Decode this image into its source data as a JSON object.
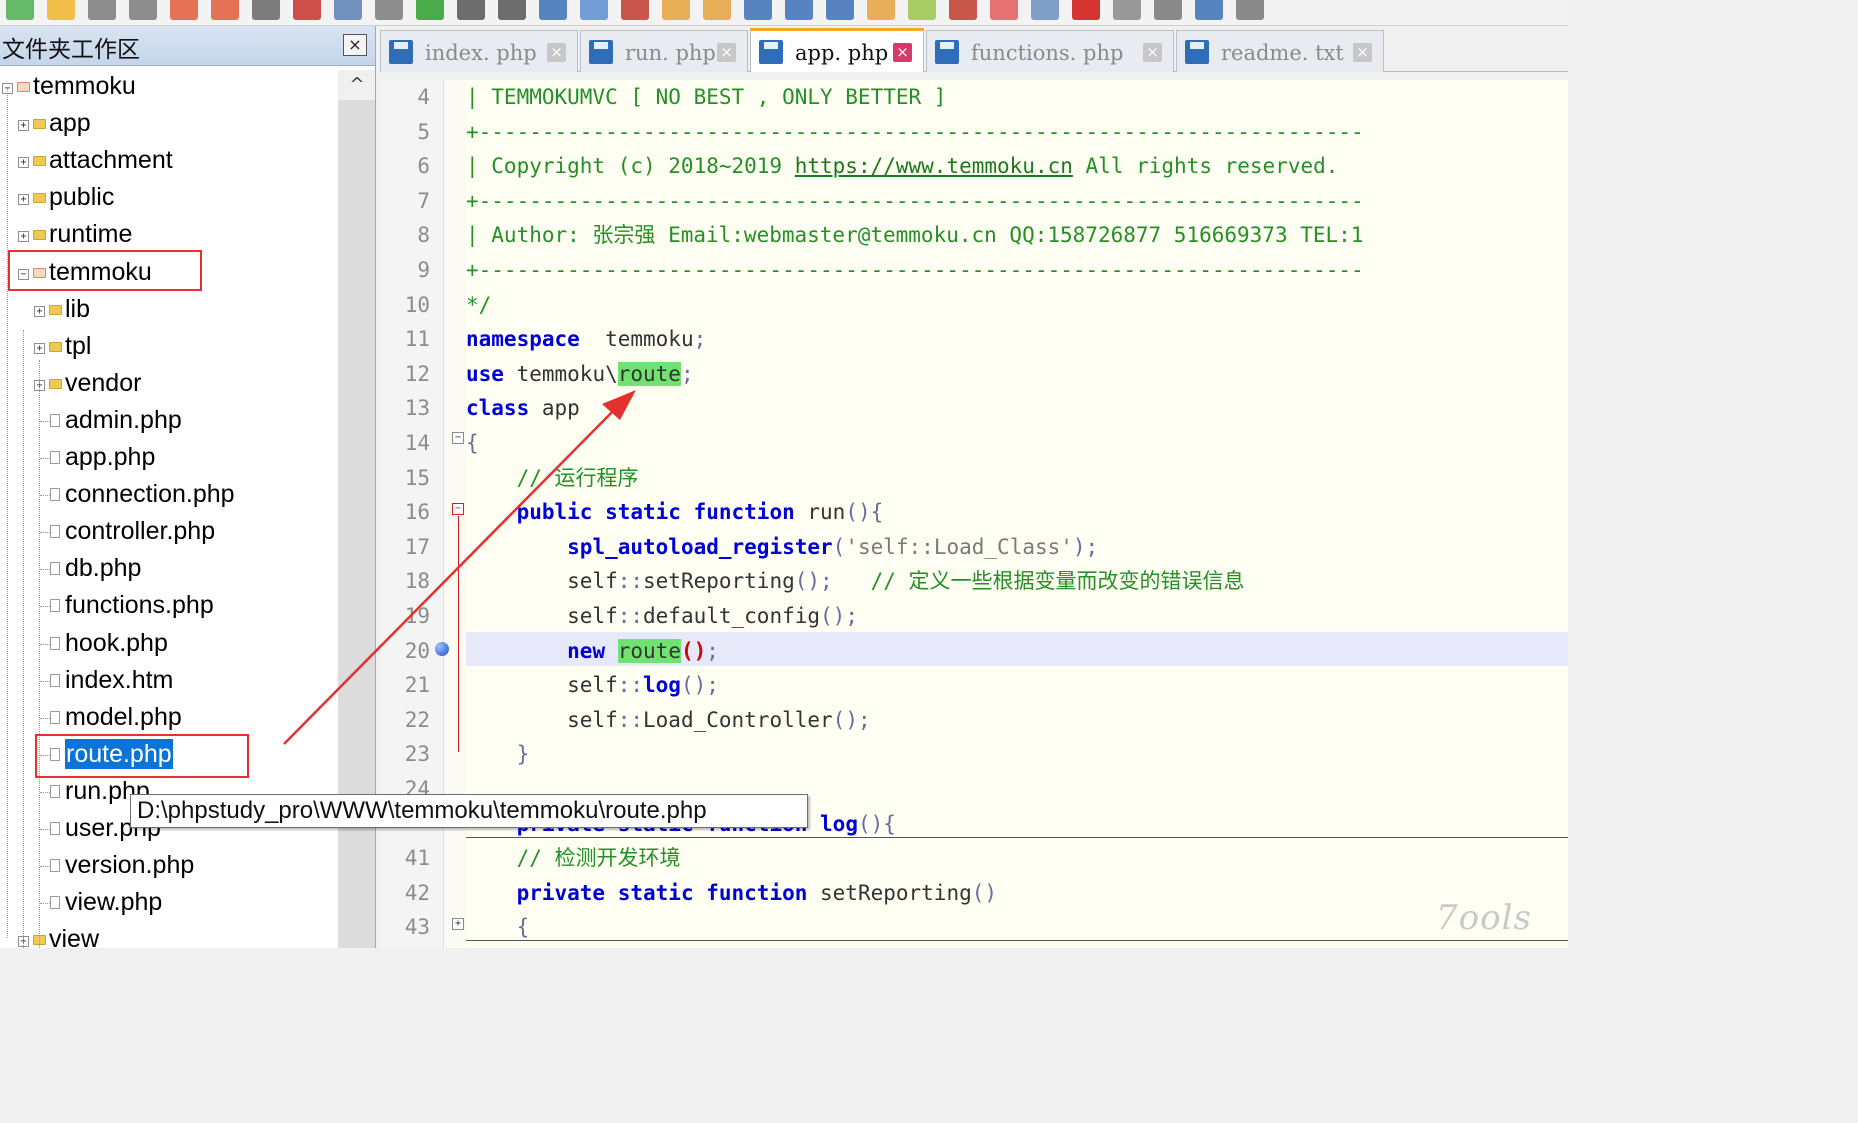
{
  "toolbar": {
    "icons": [
      "new-file-icon",
      "open-folder-icon",
      "save-icon",
      "save-all-icon",
      "close-file-icon",
      "close-all-icon",
      "print-icon",
      "cut-icon",
      "copy-icon",
      "paste-icon",
      "undo-icon",
      "redo-icon",
      "find-icon",
      "replace-icon",
      "zoom-in-icon",
      "zoom-out-icon",
      "lock-icon",
      "unlock-icon",
      "wrap-icon",
      "indent-icon",
      "format-icon",
      "bookmark-icon",
      "color-icon",
      "edit-icon",
      "window-icon",
      "view-icon",
      "record-icon",
      "stop-icon",
      "play-icon",
      "playback-icon",
      "save-macro-icon"
    ]
  },
  "left_panel": {
    "title": "文件夹工作区",
    "close_label": "×",
    "scroll_up_label": "^",
    "tree": [
      {
        "label": "temmoku",
        "level": 0,
        "type": "folder",
        "expanded": true
      },
      {
        "label": "app",
        "level": 1,
        "type": "folder",
        "expanded": false
      },
      {
        "label": "attachment",
        "level": 1,
        "type": "folder",
        "expanded": false
      },
      {
        "label": "public",
        "level": 1,
        "type": "folder",
        "expanded": false
      },
      {
        "label": "runtime",
        "level": 1,
        "type": "folder",
        "expanded": false
      },
      {
        "label": "temmoku",
        "level": 1,
        "type": "folder",
        "expanded": true
      },
      {
        "label": "lib",
        "level": 2,
        "type": "folder",
        "expanded": false
      },
      {
        "label": "tpl",
        "level": 2,
        "type": "folder",
        "expanded": false
      },
      {
        "label": "vendor",
        "level": 2,
        "type": "folder",
        "expanded": false
      },
      {
        "label": "admin.php",
        "level": 2,
        "type": "file"
      },
      {
        "label": "app.php",
        "level": 2,
        "type": "file"
      },
      {
        "label": "connection.php",
        "level": 2,
        "type": "file"
      },
      {
        "label": "controller.php",
        "level": 2,
        "type": "file"
      },
      {
        "label": "db.php",
        "level": 2,
        "type": "file"
      },
      {
        "label": "functions.php",
        "level": 2,
        "type": "file"
      },
      {
        "label": "hook.php",
        "level": 2,
        "type": "file"
      },
      {
        "label": "index.htm",
        "level": 2,
        "type": "file"
      },
      {
        "label": "model.php",
        "level": 2,
        "type": "file"
      },
      {
        "label": "route.php",
        "level": 2,
        "type": "file",
        "selected": true
      },
      {
        "label": "run.php",
        "level": 2,
        "type": "file"
      },
      {
        "label": "user.php",
        "level": 2,
        "type": "file"
      },
      {
        "label": "version.php",
        "level": 2,
        "type": "file"
      },
      {
        "label": "view.php",
        "level": 2,
        "type": "file"
      },
      {
        "label": "view",
        "level": 1,
        "type": "folder",
        "expanded": false
      }
    ]
  },
  "tabs": [
    {
      "label": "index. php",
      "active": false
    },
    {
      "label": "run. php",
      "active": false
    },
    {
      "label": "app. php",
      "active": true
    },
    {
      "label": "functions. php",
      "active": false
    },
    {
      "label": "readme. txt",
      "active": false
    }
  ],
  "tab_close_label": "×",
  "editor": {
    "lines": [
      {
        "n": "4",
        "parts": [
          [
            "cm",
            "| TEMMOKUMVC [ NO BEST , ONLY BETTER ]"
          ]
        ]
      },
      {
        "n": "5",
        "parts": [
          [
            "cm",
            "+----------------------------------------------------------------------"
          ]
        ]
      },
      {
        "n": "6",
        "parts": [
          [
            "cm",
            "| Copyright (c) 2018~2019 "
          ],
          [
            "url",
            "https://www.temmoku.cn"
          ],
          [
            "cm",
            " All rights reserved."
          ]
        ]
      },
      {
        "n": "7",
        "parts": [
          [
            "cm",
            "+----------------------------------------------------------------------"
          ]
        ]
      },
      {
        "n": "8",
        "parts": [
          [
            "cm",
            "| Author: 张宗强 Email:webmaster@temmoku.cn QQ:158726877 516669373 TEL:1"
          ]
        ]
      },
      {
        "n": "9",
        "parts": [
          [
            "cm",
            "+----------------------------------------------------------------------"
          ]
        ]
      },
      {
        "n": "10",
        "parts": [
          [
            "cm",
            "*/"
          ]
        ]
      },
      {
        "n": "11",
        "parts": [
          [
            "kw",
            "namespace"
          ],
          [
            "",
            "  temmoku"
          ],
          [
            "op",
            ";"
          ]
        ]
      },
      {
        "n": "12",
        "parts": [
          [
            "kw",
            "use"
          ],
          [
            "",
            " temmoku\\"
          ],
          [
            "hl",
            "route"
          ],
          [
            "op",
            ";"
          ]
        ]
      },
      {
        "n": "13",
        "parts": [
          [
            "kw",
            "class"
          ],
          [
            "",
            " app"
          ]
        ]
      },
      {
        "n": "14",
        "parts": [
          [
            "op",
            "{"
          ]
        ]
      },
      {
        "n": "15",
        "parts": [
          [
            "cm",
            "    // 运行程序"
          ]
        ]
      },
      {
        "n": "16",
        "parts": [
          [
            "",
            "    "
          ],
          [
            "kw",
            "public static function"
          ],
          [
            "",
            " run"
          ],
          [
            "op",
            "(){"
          ]
        ]
      },
      {
        "n": "17",
        "parts": [
          [
            "",
            "        "
          ],
          [
            "kw",
            "spl_autoload_register"
          ],
          [
            "op",
            "("
          ],
          [
            "str",
            "'self::Load_Class'"
          ],
          [
            "op",
            ");"
          ]
        ]
      },
      {
        "n": "18",
        "parts": [
          [
            "",
            "        self"
          ],
          [
            "op",
            "::"
          ],
          [
            "",
            "setReporting"
          ],
          [
            "op",
            "();"
          ],
          [
            "cm",
            "   // 定义一些根据变量而改变的错误信息"
          ]
        ]
      },
      {
        "n": "19",
        "parts": [
          [
            "",
            "        self"
          ],
          [
            "op",
            "::"
          ],
          [
            "",
            "default_config"
          ],
          [
            "op",
            "();"
          ]
        ]
      },
      {
        "n": "20",
        "parts": [
          [
            "",
            "        "
          ],
          [
            "kw",
            "new"
          ],
          [
            "",
            " "
          ],
          [
            "hl",
            "route"
          ],
          [
            "paren-red",
            "()"
          ],
          [
            "op",
            ";"
          ]
        ]
      },
      {
        "n": "21",
        "parts": [
          [
            "",
            "        self"
          ],
          [
            "op",
            "::"
          ],
          [
            "kw",
            "log"
          ],
          [
            "op",
            "();"
          ]
        ]
      },
      {
        "n": "22",
        "parts": [
          [
            "",
            "        self"
          ],
          [
            "op",
            "::"
          ],
          [
            "",
            "Load_Controller"
          ],
          [
            "op",
            "();"
          ]
        ]
      },
      {
        "n": "23",
        "parts": [
          [
            "op",
            "    }"
          ]
        ]
      },
      {
        "n": "24",
        "parts": [
          [
            "",
            ""
          ]
        ]
      },
      {
        "n": "",
        "parts": [
          [
            "",
            "    "
          ],
          [
            "kw",
            "private static function"
          ],
          [
            "",
            " "
          ],
          [
            "kw",
            "log"
          ],
          [
            "op",
            "(){"
          ]
        ]
      },
      {
        "n": "41",
        "parts": [
          [
            "cm",
            "    // 检测开发环境"
          ]
        ]
      },
      {
        "n": "42",
        "parts": [
          [
            "",
            "    "
          ],
          [
            "kw",
            "private static function"
          ],
          [
            "",
            " setReporting"
          ],
          [
            "op",
            "()"
          ]
        ]
      },
      {
        "n": "43",
        "parts": [
          [
            "op",
            "    {"
          ]
        ]
      }
    ]
  },
  "tooltip": "D:\\phpstudy_pro\\WWW\\temmoku\\temmoku\\route.php",
  "watermark": "7ools",
  "colors": {
    "selection": "#0a74d8",
    "highlight": "#6fe26f",
    "annotation": "#e53030",
    "keyword": "#0000d8",
    "comment": "#259025"
  }
}
